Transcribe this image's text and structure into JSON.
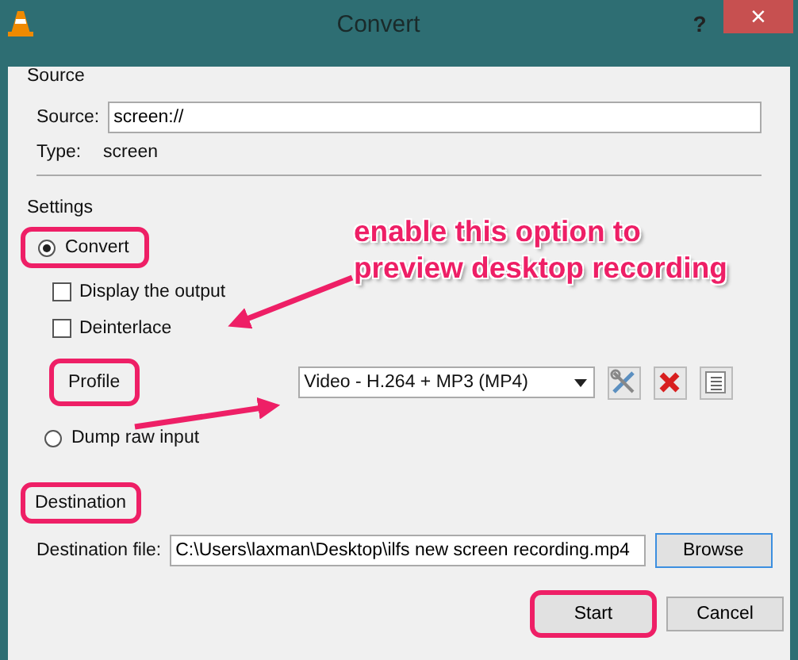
{
  "window": {
    "title": "Convert",
    "help": "?",
    "close": "×"
  },
  "source": {
    "heading": "Source",
    "label": "Source:",
    "value": "screen://",
    "type_label": "Type:",
    "type_value": "screen"
  },
  "settings": {
    "heading": "Settings",
    "modes": [
      {
        "label": "Convert",
        "selected": true,
        "highlighted": true
      },
      {
        "label": "Dump raw input",
        "selected": false,
        "highlighted": false
      }
    ],
    "options": [
      {
        "label": "Display the output",
        "checked": false
      },
      {
        "label": "Deinterlace",
        "checked": false
      }
    ],
    "profile": {
      "label": "Profile",
      "highlighted": true,
      "value": "Video - H.264 + MP3 (MP4)"
    }
  },
  "destination": {
    "heading": "Destination",
    "highlighted": true,
    "label": "Destination file:",
    "value": "C:\\Users\\laxman\\Desktop\\ilfs new screen recording.mp4",
    "browse": "Browse"
  },
  "buttons": [
    {
      "label": "Start",
      "highlighted": true
    },
    {
      "label": "Cancel",
      "highlighted": false
    }
  ],
  "annotation": {
    "lines": [
      "enable this option to",
      "preview desktop recording"
    ]
  }
}
